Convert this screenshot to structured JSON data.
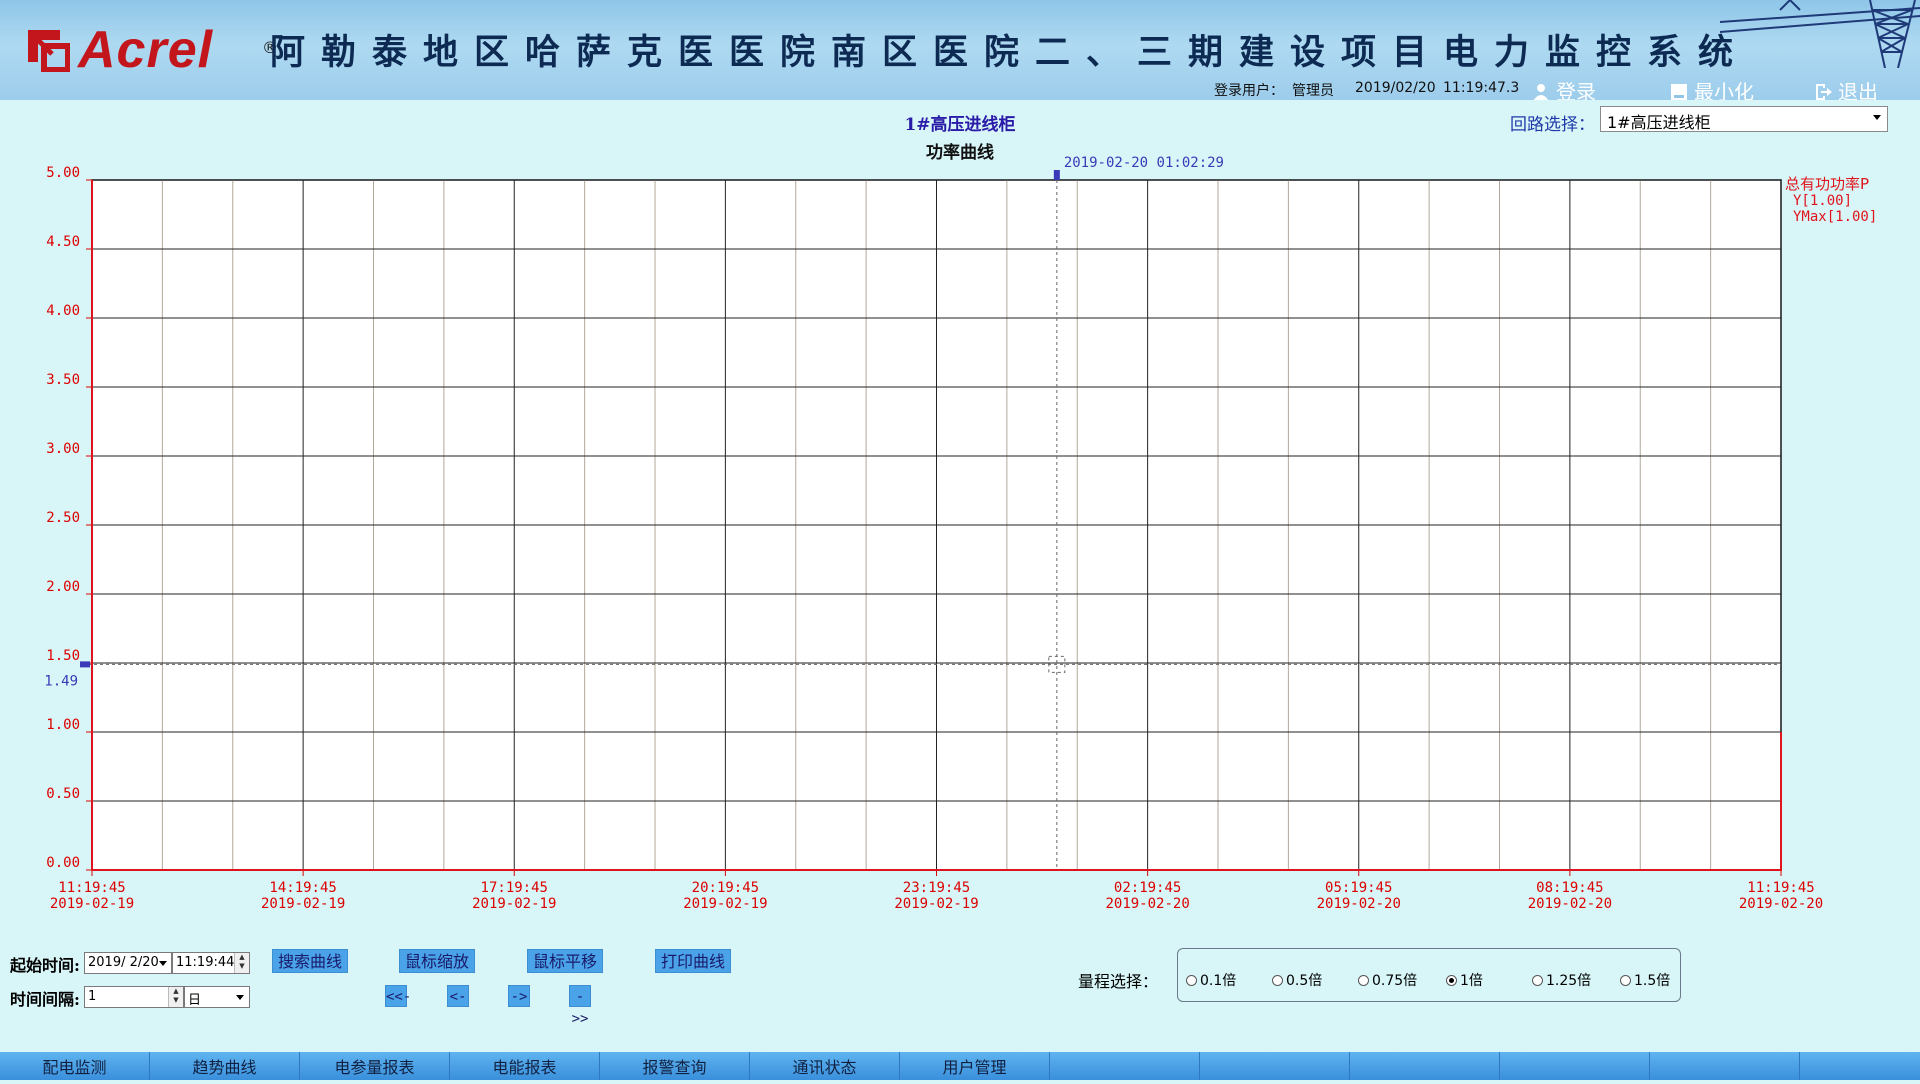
{
  "header": {
    "logo_text": "Acrel",
    "logo_registered": "®",
    "title": "阿勒泰地区哈萨克医医院南区医院二、三期建设项目电力监控系统",
    "user_label": "登录用户：",
    "user_name": "管理员",
    "date": "2019/02/20",
    "time": "11:19:47.3",
    "login_label": "登录",
    "minimize_label": "最小化",
    "exit_label": "退出"
  },
  "chart_panel": {
    "title": "1#高压进线柜",
    "subtitle": "功率曲线",
    "circuit_label": "回路选择：",
    "circuit_value": "1#高压进线柜"
  },
  "chart_data": {
    "type": "line",
    "title": "功率曲线",
    "y_ticks": [
      "5.00",
      "4.50",
      "4.00",
      "3.50",
      "3.00",
      "2.50",
      "2.00",
      "1.50",
      "1.00",
      "0.50",
      "0.00"
    ],
    "ylim": [
      0,
      5
    ],
    "x_ticks": [
      {
        "time": "11:19:45",
        "date": "2019-02-19"
      },
      {
        "time": "14:19:45",
        "date": "2019-02-19"
      },
      {
        "time": "17:19:45",
        "date": "2019-02-19"
      },
      {
        "time": "20:19:45",
        "date": "2019-02-19"
      },
      {
        "time": "23:19:45",
        "date": "2019-02-19"
      },
      {
        "time": "02:19:45",
        "date": "2019-02-20"
      },
      {
        "time": "05:19:45",
        "date": "2019-02-20"
      },
      {
        "time": "08:19:45",
        "date": "2019-02-20"
      },
      {
        "time": "11:19:45",
        "date": "2019-02-20"
      }
    ],
    "cursor": {
      "label": "2019-02-20 01:02:29",
      "y_value": "1.49",
      "x_hours": 13.71,
      "y": 1.49
    },
    "legend": {
      "series": "总有功功率P",
      "y": "Y[1.00]",
      "ymax": "YMax[1.00]"
    },
    "series": [
      {
        "name": "总有功功率P",
        "points": [
          [
            0,
            0
          ],
          [
            24,
            0
          ],
          [
            24,
            1.0
          ]
        ]
      }
    ],
    "grid": true
  },
  "controls": {
    "start_time_label": "起始时间:",
    "start_date": "2019/ 2/20",
    "start_time": "11:19:44",
    "interval_label": "时间间隔:",
    "interval_value": "1",
    "interval_unit": "日",
    "buttons": {
      "search": "搜索曲线",
      "zoom": "鼠标缩放",
      "pan": "鼠标平移",
      "print": "打印曲线"
    },
    "nav": {
      "first": "<<-",
      "prev": "<-",
      "next": "->",
      "last": "->>"
    },
    "range_label": "量程选择：",
    "range_options": [
      "0.1倍",
      "0.5倍",
      "0.75倍",
      "1倍",
      "1.25倍",
      "1.5倍"
    ],
    "range_selected": "1倍"
  },
  "bottom_nav": [
    "配电监测",
    "趋势曲线",
    "电参量报表",
    "电能报表",
    "报警查询",
    "通讯状态",
    "用户管理"
  ]
}
